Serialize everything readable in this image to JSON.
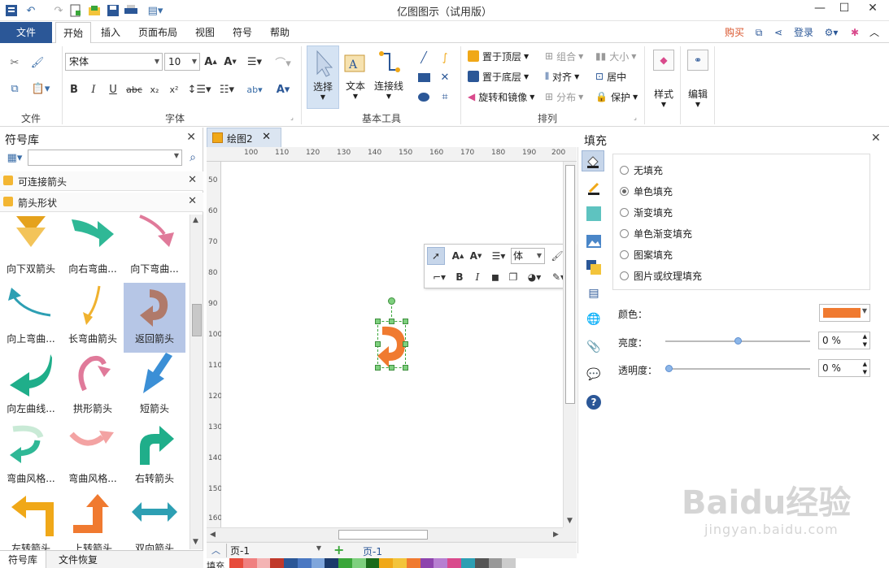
{
  "app": {
    "title": "亿图图示（试用版）"
  },
  "menu": {
    "file": "文件",
    "tabs": [
      "开始",
      "插入",
      "页面布局",
      "视图",
      "符号",
      "帮助"
    ],
    "right": {
      "buy": "购买",
      "login": "登录"
    }
  },
  "ribbon": {
    "font_name": "宋体",
    "font_size": "10",
    "groups": {
      "file": "文件",
      "font": "字体",
      "tools": "基本工具",
      "arrange": "排列"
    },
    "tools": {
      "select": "选择",
      "text": "文本",
      "connector": "连接线"
    },
    "arrange_items": {
      "top": "置于顶层",
      "bottom": "置于底层",
      "rotate": "旋转和镜像",
      "group": "组合",
      "align": "对齐",
      "distribute": "分布",
      "size": "大小",
      "center": "居中",
      "protect": "保护"
    },
    "style": "样式",
    "edit": "编辑"
  },
  "left_panel": {
    "title": "符号库",
    "sections": [
      "可连接箭头",
      "箭头形状"
    ],
    "shapes": [
      {
        "label": "向下双箭头",
        "color": "#e5a21c"
      },
      {
        "label": "向右弯曲...",
        "color": "#2fb896"
      },
      {
        "label": "向下弯曲...",
        "color": "#e07a9a"
      },
      {
        "label": "向上弯曲...",
        "color": "#2d9fb3"
      },
      {
        "label": "长弯曲箭头",
        "color": "#f0b22f"
      },
      {
        "label": "返回箭头",
        "color": "#b07a6a"
      },
      {
        "label": "向左曲线...",
        "color": "#1fae8a"
      },
      {
        "label": "拱形箭头",
        "color": "#e07a9a"
      },
      {
        "label": "短箭头",
        "color": "#3b8fd6"
      },
      {
        "label": "弯曲风格...",
        "color": "#9fd7b5"
      },
      {
        "label": "弯曲风格...",
        "color": "#f3a3a3"
      },
      {
        "label": "右转箭头",
        "color": "#1fae8a"
      },
      {
        "label": "左转箭头",
        "color": "#f0a818"
      },
      {
        "label": "上转箭头",
        "color": "#f07a30"
      },
      {
        "label": "双向箭头",
        "color": "#2d9fb3"
      }
    ],
    "bottom_tabs": [
      "符号库",
      "文件恢复"
    ]
  },
  "canvas": {
    "doc_tab": "绘图2",
    "hruler": [
      "100",
      "110",
      "120",
      "130",
      "140",
      "150",
      "160",
      "170",
      "180",
      "190",
      "200"
    ],
    "vruler": [
      "50",
      "60",
      "70",
      "80",
      "90",
      "100",
      "110",
      "120",
      "130",
      "140",
      "150",
      "160"
    ],
    "float_font": "体",
    "shape_color": "#f07a30",
    "page_name": "页-1",
    "fill_label": "填充"
  },
  "fill_panel": {
    "title": "填充",
    "options": [
      "无填充",
      "单色填充",
      "渐变填充",
      "单色渐变填充",
      "图案填充",
      "图片或纹理填充"
    ],
    "selected_option": "单色填充",
    "color_label": "颜色：",
    "color_value": "#f07a30",
    "brightness_label": "亮度：",
    "brightness_value": "0 %",
    "transparency_label": "透明度：",
    "transparency_value": "0 %"
  },
  "watermark": {
    "main": "Baidu经验",
    "sub": "jingyan.baidu.com"
  }
}
